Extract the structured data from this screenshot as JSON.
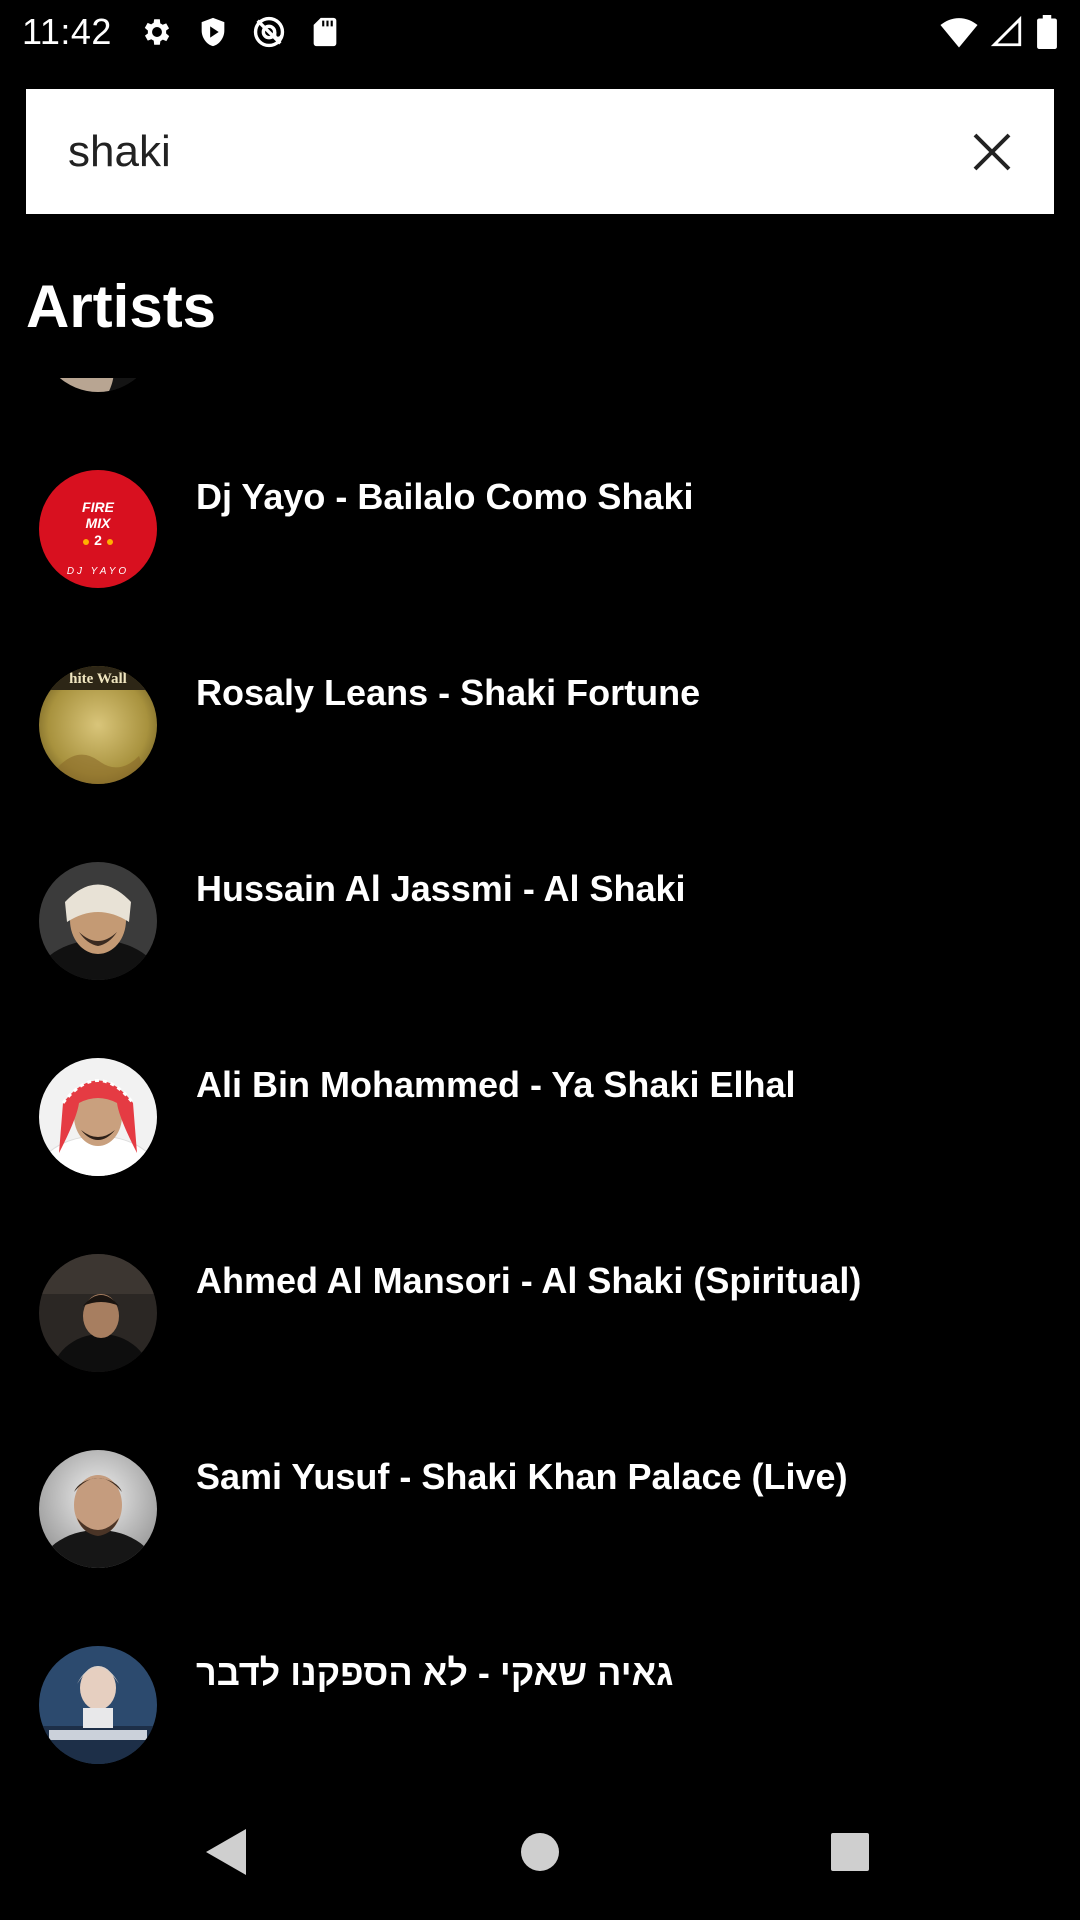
{
  "status_bar": {
    "time": "11:42",
    "left_icons": [
      "gear-icon",
      "shield-icon",
      "at-sign-icon",
      "sd-card-icon"
    ],
    "right_icons": [
      "wifi-icon",
      "cell-signal-icon",
      "battery-icon"
    ]
  },
  "search": {
    "value": "shaki",
    "placeholder": ""
  },
  "section": {
    "title": "Artists"
  },
  "results": [
    {
      "title": "",
      "avatar": "partial-artist-photo"
    },
    {
      "title": "Dj Yayo - Bailalo Como Shaki",
      "avatar": "fire-mix-cover",
      "cover_text": [
        "FIRE",
        "MIX",
        "2",
        "DJ YAYO"
      ]
    },
    {
      "title": "Rosaly Leans - Shaki Fortune",
      "avatar": "white-walls-cover",
      "cover_text": [
        "hite Wall"
      ]
    },
    {
      "title": "Hussain Al Jassmi - Al Shaki",
      "avatar": "artist-photo"
    },
    {
      "title": "Ali Bin Mohammed - Ya Shaki Elhal",
      "avatar": "artist-photo"
    },
    {
      "title": "Ahmed Al Mansori - Al Shaki (Spiritual)",
      "avatar": "artist-photo"
    },
    {
      "title": "Sami Yusuf - Shaki Khan Palace (Live)",
      "avatar": "artist-photo"
    },
    {
      "title": "גאיה שאקי - לא הספקנו לדבר",
      "avatar": "artist-photo"
    }
  ],
  "nav_bar": {
    "icons": [
      "back-icon",
      "home-icon",
      "recents-icon"
    ]
  },
  "colors": {
    "background": "#000000",
    "search_background": "#ffffff",
    "text": "#ffffff",
    "fire_mix_red": "#d8101f"
  }
}
